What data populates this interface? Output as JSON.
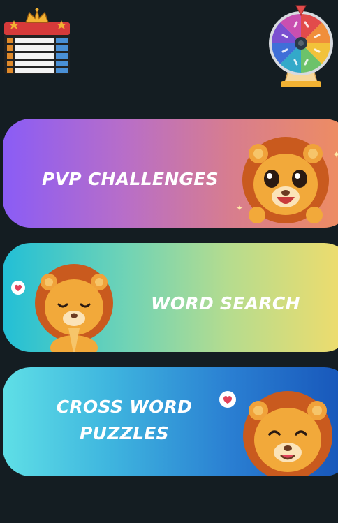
{
  "toolbar": {
    "leaderboard_icon": "leaderboard-crown-icon",
    "spin_wheel_icon": "spin-wheel-icon"
  },
  "menu": {
    "pvp": {
      "label": "PVP CHALLENGES",
      "mascot": "lion-cheering"
    },
    "word_search": {
      "label": "WORD SEARCH",
      "mascot": "lion-praying"
    },
    "crossword": {
      "label": "CROSS WORD PUZZLES",
      "mascot": "lion-happy"
    }
  },
  "colors": {
    "background": "#141d22",
    "pvp_gradient": [
      "#8a5cf6",
      "#f08e5e"
    ],
    "word_search_gradient": [
      "#22bfd6",
      "#f3dc6a"
    ],
    "crossword_gradient": [
      "#5fdfe6",
      "#1653b8"
    ]
  }
}
